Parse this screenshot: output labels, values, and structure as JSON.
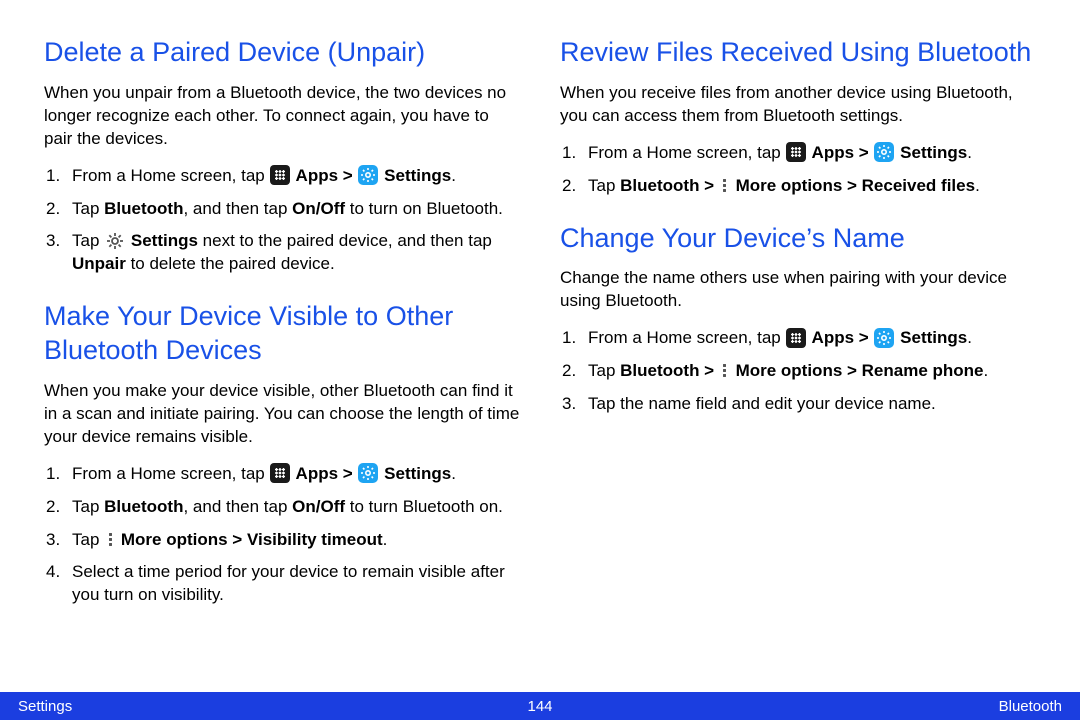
{
  "left": {
    "section1": {
      "heading": "Delete a Paired Device (Unpair)",
      "intro": "When you unpair from a Bluetooth device, the two devices no longer recognize each other. To connect again, you have to pair the devices.",
      "step1_a": "From a Home screen, tap ",
      "step1_apps": " Apps > ",
      "step1_settings": " Settings",
      "step1_end": ".",
      "step2_a": "Tap ",
      "step2_bt": "Bluetooth",
      "step2_b": ", and then tap ",
      "step2_onoff": "On/Off",
      "step2_c": " to turn on Bluetooth.",
      "step3_a": "Tap ",
      "step3_settings": " Settings",
      "step3_b": " next to the paired device, and then tap ",
      "step3_unpair": "Unpair",
      "step3_c": " to delete the paired device."
    },
    "section2": {
      "heading": "Make Your Device Visible to Other Bluetooth Devices",
      "intro": "When you make your device visible, other Bluetooth can find it in a scan and initiate pairing. You can choose the length of time your device remains visible.",
      "step1_a": "From a Home screen, tap ",
      "step1_apps": " Apps > ",
      "step1_settings": " Settings",
      "step1_end": ".",
      "step2_a": "Tap ",
      "step2_bt": "Bluetooth",
      "step2_b": ", and then tap ",
      "step2_onoff": "On/Off",
      "step2_c": " to turn Bluetooth on.",
      "step3_a": "Tap ",
      "step3_more": " More options > Visibility timeout",
      "step3_end": ".",
      "step4": "Select a time period for your device to remain visible after you turn on visibility."
    }
  },
  "right": {
    "section1": {
      "heading": "Review Files Received Using Bluetooth",
      "intro": "When you receive files from another device using Bluetooth, you can access them from Bluetooth settings.",
      "step1_a": "From a Home screen, tap ",
      "step1_apps": " Apps > ",
      "step1_settings": " Settings",
      "step1_end": ".",
      "step2_a": "Tap ",
      "step2_bt": "Bluetooth > ",
      "step2_more": " More options > Received files",
      "step2_end": "."
    },
    "section2": {
      "heading": "Change Your Device’s Name",
      "intro": "Change the name others use when pairing with your device using Bluetooth.",
      "step1_a": "From a Home screen, tap ",
      "step1_apps": " Apps > ",
      "step1_settings": " Settings",
      "step1_end": ".",
      "step2_a": "Tap ",
      "step2_bt": "Bluetooth > ",
      "step2_more": " More options > Rename phone",
      "step2_end": ".",
      "step3": "Tap the name field and edit your device name."
    }
  },
  "footer": {
    "left": "Settings",
    "center": "144",
    "right": "Bluetooth"
  }
}
